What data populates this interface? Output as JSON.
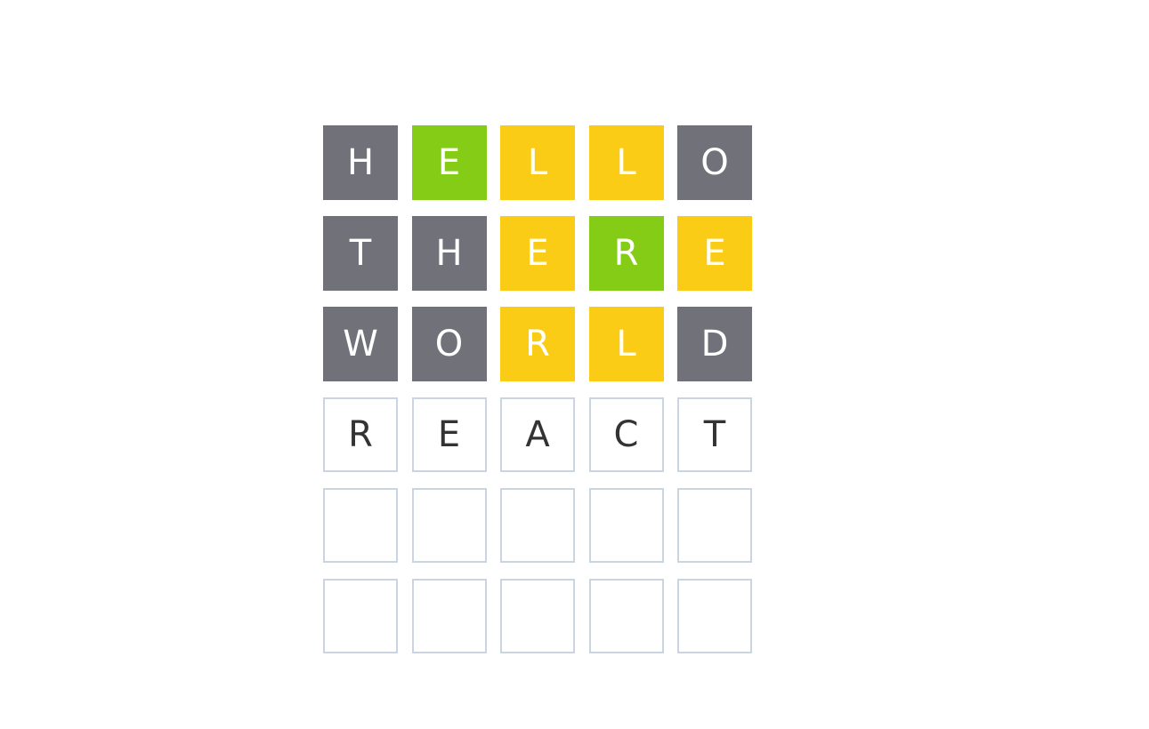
{
  "colors": {
    "absent": "#71717a",
    "correct": "#84cc16",
    "present": "#facc15",
    "empty_border": "#cbd5e1",
    "pending_text": "#333333"
  },
  "board": {
    "rows": [
      {
        "tiles": [
          {
            "letter": "H",
            "status": "absent"
          },
          {
            "letter": "E",
            "status": "correct"
          },
          {
            "letter": "L",
            "status": "present"
          },
          {
            "letter": "L",
            "status": "present"
          },
          {
            "letter": "O",
            "status": "absent"
          }
        ]
      },
      {
        "tiles": [
          {
            "letter": "T",
            "status": "absent"
          },
          {
            "letter": "H",
            "status": "absent"
          },
          {
            "letter": "E",
            "status": "present"
          },
          {
            "letter": "R",
            "status": "correct"
          },
          {
            "letter": "E",
            "status": "present"
          }
        ]
      },
      {
        "tiles": [
          {
            "letter": "W",
            "status": "absent"
          },
          {
            "letter": "O",
            "status": "absent"
          },
          {
            "letter": "R",
            "status": "present"
          },
          {
            "letter": "L",
            "status": "present"
          },
          {
            "letter": "D",
            "status": "absent"
          }
        ]
      },
      {
        "tiles": [
          {
            "letter": "R",
            "status": "pending"
          },
          {
            "letter": "E",
            "status": "pending"
          },
          {
            "letter": "A",
            "status": "pending"
          },
          {
            "letter": "C",
            "status": "pending"
          },
          {
            "letter": "T",
            "status": "pending"
          }
        ]
      },
      {
        "tiles": [
          {
            "letter": "",
            "status": "empty"
          },
          {
            "letter": "",
            "status": "empty"
          },
          {
            "letter": "",
            "status": "empty"
          },
          {
            "letter": "",
            "status": "empty"
          },
          {
            "letter": "",
            "status": "empty"
          }
        ]
      },
      {
        "tiles": [
          {
            "letter": "",
            "status": "empty"
          },
          {
            "letter": "",
            "status": "empty"
          },
          {
            "letter": "",
            "status": "empty"
          },
          {
            "letter": "",
            "status": "empty"
          },
          {
            "letter": "",
            "status": "empty"
          }
        ]
      }
    ]
  }
}
